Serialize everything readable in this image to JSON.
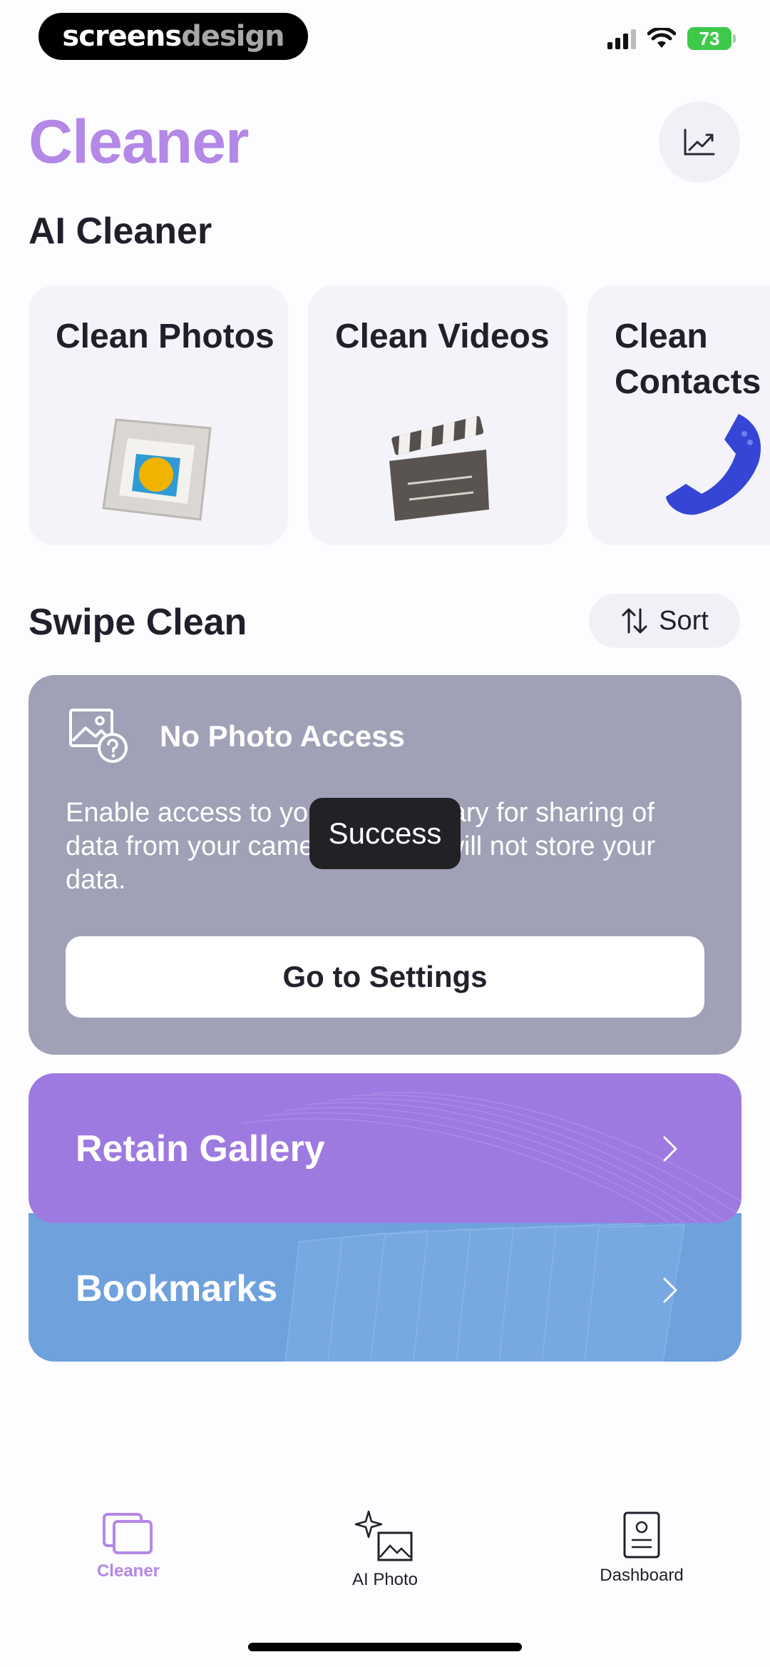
{
  "brand": {
    "part1": "screens",
    "part2": "design"
  },
  "status_bar": {
    "battery": "73"
  },
  "header": {
    "title": "Cleaner",
    "stats_icon": "trending-chart-icon"
  },
  "ai_cleaner": {
    "title": "AI Cleaner",
    "cards": [
      {
        "label": "Clean Photos",
        "icon": "photo-frame-icon"
      },
      {
        "label": "Clean Videos",
        "icon": "clapperboard-icon"
      },
      {
        "label": "Clean Contacts",
        "icon": "phone-icon"
      }
    ]
  },
  "swipe_clean": {
    "title": "Swipe Clean",
    "sort_label": "Sort",
    "access": {
      "title": "No Photo Access",
      "text": "Enable access to your photo library for sharing of data from your camera roll. We will not store your data.",
      "button": "Go to Settings"
    }
  },
  "toast": "Success",
  "banners": {
    "retain": "Retain Gallery",
    "bookmarks": "Bookmarks"
  },
  "tabs": [
    {
      "label": "Cleaner",
      "active": true
    },
    {
      "label": "AI Photo",
      "active": false
    },
    {
      "label": "Dashboard",
      "active": false
    }
  ],
  "colors": {
    "accent": "#b388e6",
    "retain": "#9d7ae0",
    "bookmarks": "#6fa1dd",
    "panel": "#a0a1b6"
  }
}
